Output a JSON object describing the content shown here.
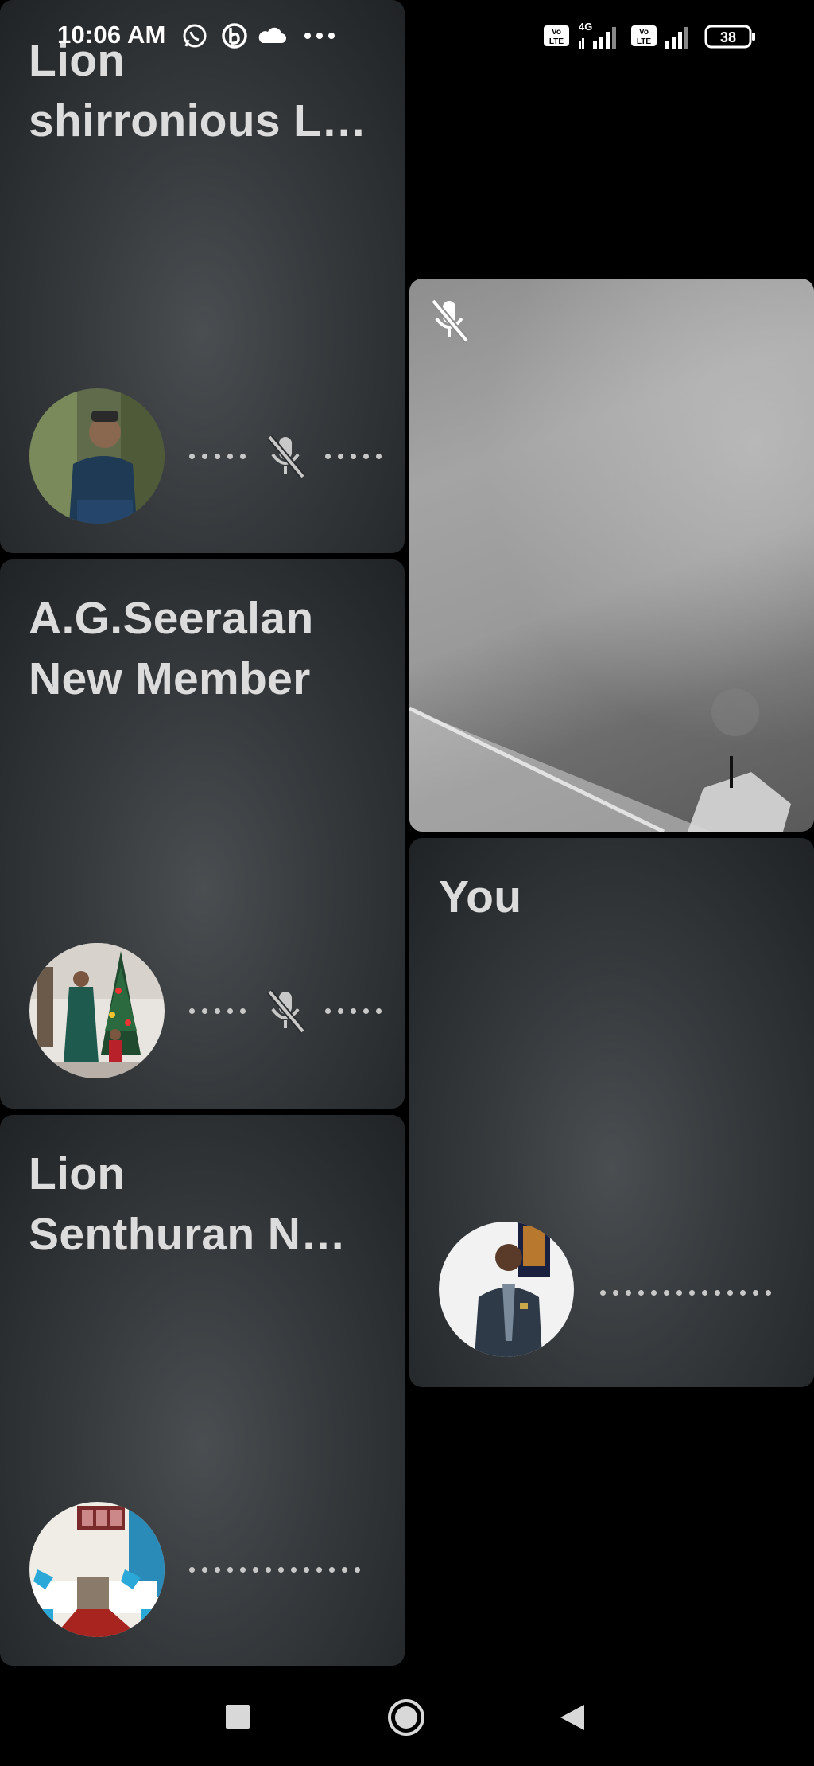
{
  "status_bar": {
    "time": "10:06 AM",
    "icons": [
      "whatsapp-icon",
      "b-app-icon",
      "cloud-icon",
      "more-dots-icon"
    ],
    "right_icons": [
      "volte-icon",
      "4g-signal-icon",
      "volte-icon",
      "signal-icon",
      "battery-icon"
    ],
    "network_label": "4G",
    "volte_label": "Vo LTE",
    "battery": "38"
  },
  "participants": [
    {
      "name": "Lion\nshirronious L…",
      "muted": true
    },
    {
      "name": "A.G.Seeralan\nNew Member",
      "muted": true
    },
    {
      "name": "Lion\nSenthuran N…",
      "muted": false
    },
    {
      "name": "You",
      "muted": false
    }
  ],
  "video_tile": {
    "muted": true
  },
  "nav": [
    "recent-apps-button",
    "home-button",
    "back-button"
  ]
}
